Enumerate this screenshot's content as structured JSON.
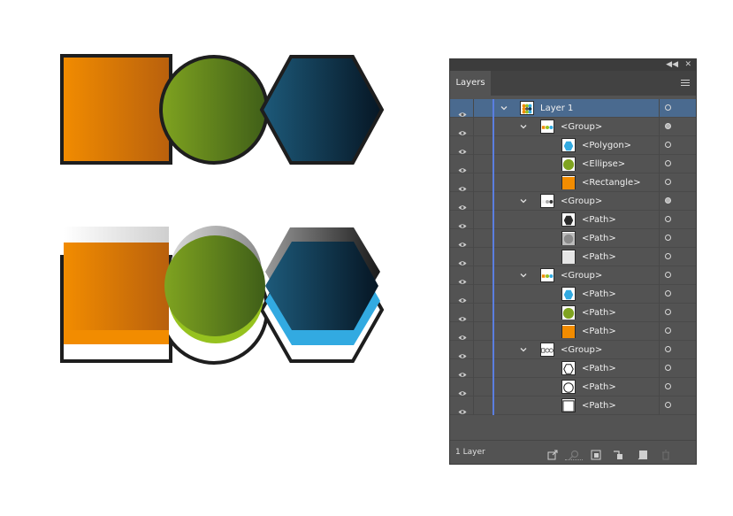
{
  "panel": {
    "tab_label": "Layers",
    "status_text": "1 Layer",
    "collapse_icon": "double-chevron-left-icon",
    "close_icon": "close-icon",
    "menu_icon": "panel-menu-icon"
  },
  "colors": {
    "orange": "#ee8c00",
    "green": "#96c21f",
    "blue": "#32aae1",
    "dark_blue": "#0b3c5c",
    "stroke": "#1e1e1e",
    "selection": "#4a6a8f",
    "layer_color": "#5a7ee0"
  },
  "layers": [
    {
      "label": "Layer 1",
      "level": 0,
      "expanded": true,
      "thumb": "layer",
      "target": "hollow"
    },
    {
      "label": "<Group>",
      "level": 1,
      "expanded": true,
      "thumb": "group-color",
      "target": "filled"
    },
    {
      "label": "<Polygon>",
      "level": 2,
      "thumb": "blue-hexagon",
      "target": "hollow"
    },
    {
      "label": "<Ellipse>",
      "level": 2,
      "thumb": "green-circle",
      "target": "hollow"
    },
    {
      "label": "<Rectangle>",
      "level": 2,
      "thumb": "orange-square",
      "target": "hollow"
    },
    {
      "label": "<Group>",
      "level": 1,
      "expanded": true,
      "thumb": "group-gray",
      "target": "filled"
    },
    {
      "label": "<Path>",
      "level": 2,
      "thumb": "gray-hexagon",
      "target": "hollow"
    },
    {
      "label": "<Path>",
      "level": 2,
      "thumb": "gray-circle",
      "target": "hollow"
    },
    {
      "label": "<Path>",
      "level": 2,
      "thumb": "gray-square",
      "target": "hollow"
    },
    {
      "label": "<Group>",
      "level": 1,
      "expanded": true,
      "thumb": "group-color",
      "target": "hollow"
    },
    {
      "label": "<Path>",
      "level": 2,
      "thumb": "blue-hexagon",
      "target": "hollow"
    },
    {
      "label": "<Path>",
      "level": 2,
      "thumb": "green-circle",
      "target": "hollow"
    },
    {
      "label": "<Path>",
      "level": 2,
      "thumb": "orange-square",
      "target": "hollow"
    },
    {
      "label": "<Group>",
      "level": 1,
      "expanded": true,
      "thumb": "group-outline",
      "target": "hollow"
    },
    {
      "label": "<Path>",
      "level": 2,
      "thumb": "outline-hexagon",
      "target": "hollow"
    },
    {
      "label": "<Path>",
      "level": 2,
      "thumb": "outline-circle",
      "target": "hollow"
    },
    {
      "label": "<Path>",
      "level": 2,
      "thumb": "outline-square",
      "target": "hollow"
    }
  ],
  "footer_icons": [
    "export-icon",
    "locate-object-icon",
    "make-clipping-mask-icon",
    "new-sublayer-icon",
    "new-layer-icon",
    "delete-icon"
  ]
}
